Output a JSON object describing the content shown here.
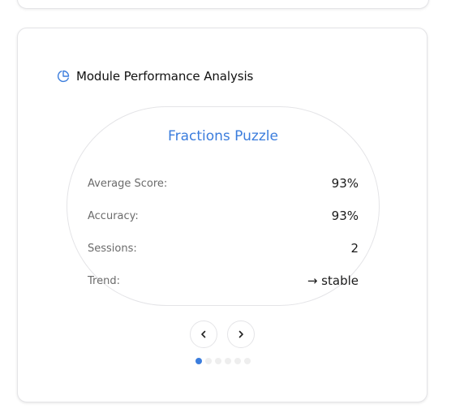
{
  "section": {
    "title": "Module Performance Analysis",
    "title_icon": "pie-chart-icon"
  },
  "module": {
    "name": "Fractions Puzzle",
    "stats": [
      {
        "label": "Average Score:",
        "value": "93%"
      },
      {
        "label": "Accuracy:",
        "value": "93%"
      },
      {
        "label": "Sessions:",
        "value": "2"
      },
      {
        "label": "Trend:",
        "value": "→ stable"
      }
    ]
  },
  "carousel": {
    "prev_icon": "chevron-left-icon",
    "next_icon": "chevron-right-icon",
    "active_index": 0,
    "total_slides": 6
  },
  "colors": {
    "accent": "#3b7ddd",
    "border": "#e4e4e7",
    "dot_inactive": "#eeeeee"
  }
}
